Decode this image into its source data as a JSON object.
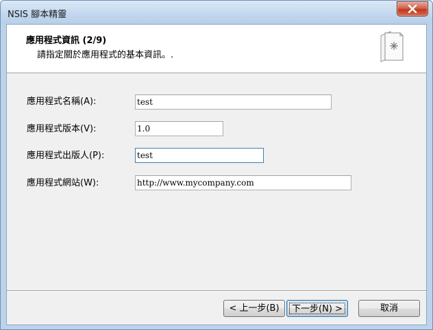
{
  "window": {
    "title": "NSIS 腳本精靈"
  },
  "header": {
    "title": "應用程式資訊 (2/9)",
    "subtitle": "請指定關於應用程式的基本資訊。."
  },
  "form": {
    "fields": [
      {
        "label": "應用程式名稱(A):",
        "value": "test"
      },
      {
        "label": "應用程式版本(V):",
        "value": "1.0"
      },
      {
        "label": "應用程式出版人(P):",
        "value": "test"
      },
      {
        "label": "應用程式網站(W):",
        "value": "http://www.mycompany.com"
      }
    ]
  },
  "buttons": {
    "back": "< 上一步(B)",
    "next": "下一步(N) >",
    "cancel": "取消"
  }
}
